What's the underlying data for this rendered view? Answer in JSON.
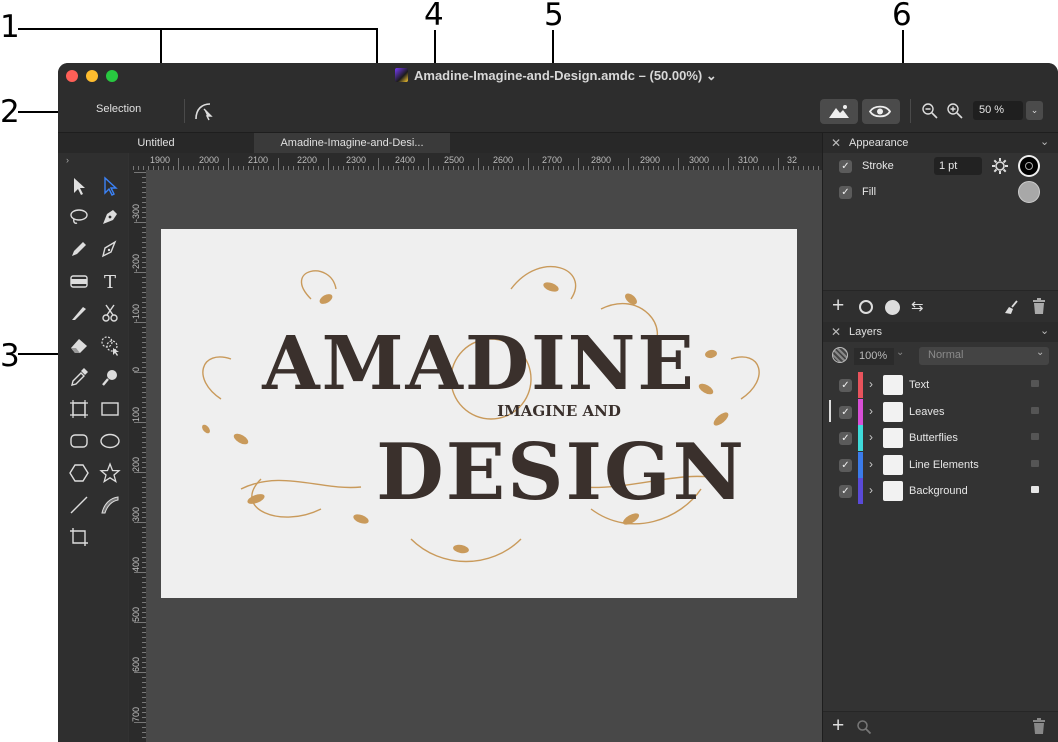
{
  "callouts": [
    "1",
    "2",
    "3",
    "4",
    "5",
    "6"
  ],
  "window": {
    "title": "Amadine-Imagine-and-Design.amdc – (50.00%)",
    "title_chevron": "⌄"
  },
  "toolbar": {
    "tool_name": "Selection",
    "zoom_value": "50 %",
    "zoom_dropdown": "⌄"
  },
  "tabs": [
    {
      "label": "Untitled"
    },
    {
      "label": "Amadine-Imagine-and-Desi..."
    }
  ],
  "ruler": {
    "unit": "pt",
    "h_labels": [
      "1900",
      "2000",
      "2100",
      "2200",
      "2300",
      "2400",
      "2500",
      "2600",
      "2700",
      "2800",
      "2900",
      "3000",
      "3100",
      "32"
    ],
    "v_labels": [
      "-300",
      "-200",
      "-100",
      "0",
      "100",
      "200",
      "300",
      "400",
      "500",
      "600",
      "700"
    ]
  },
  "appearance": {
    "title": "Appearance",
    "stroke_label": "Stroke",
    "stroke_width": "1 pt",
    "fill_label": "Fill",
    "stroke_checked": "✓",
    "fill_checked": "✓"
  },
  "layers": {
    "title": "Layers",
    "opacity": "100%",
    "blend_mode": "Normal",
    "items": [
      {
        "name": "Text",
        "color": "#e8535c",
        "locked": false
      },
      {
        "name": "Leaves",
        "color": "#d84fd6",
        "locked": false
      },
      {
        "name": "Butterflies",
        "color": "#3fdada",
        "locked": false
      },
      {
        "name": "Line Elements",
        "color": "#3b7bea",
        "locked": false
      },
      {
        "name": "Background",
        "color": "#5a4ad8",
        "locked": true
      }
    ]
  },
  "artwork": {
    "line1": "AMADINE",
    "line2": "IMAGINE AND",
    "line3": "DESIGN"
  },
  "colors": {
    "accent_blue": "#3b82f6",
    "artwork_dark": "#3a302c",
    "artwork_gold": "#c99a5b"
  }
}
